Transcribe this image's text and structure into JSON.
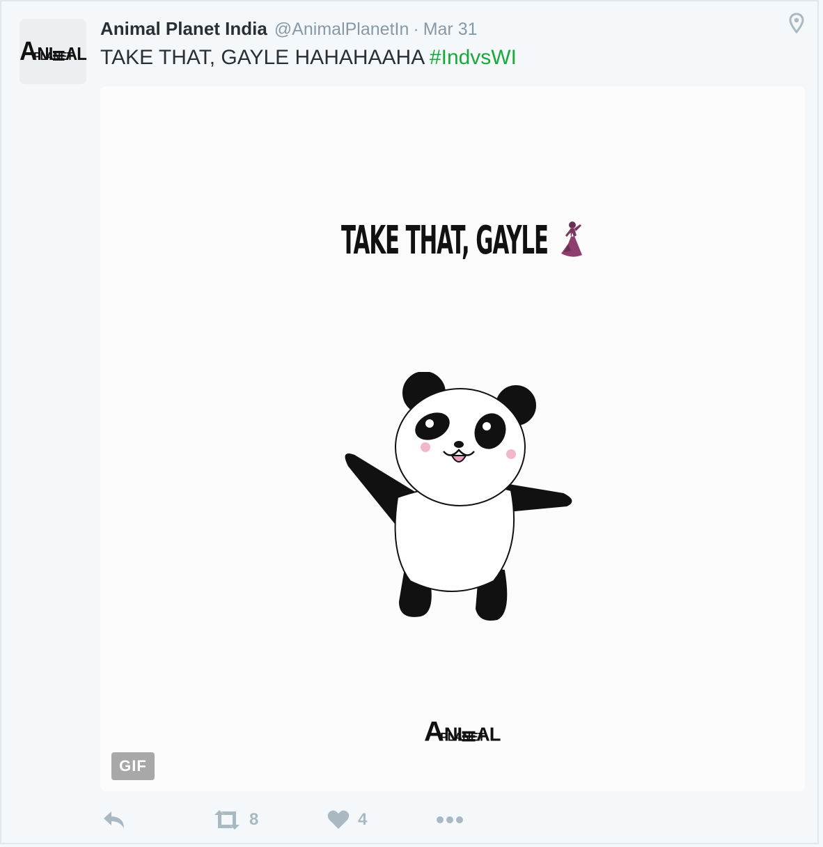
{
  "tweet": {
    "author_name": "Animal Planet India",
    "author_handle": "@AnimalPlanetIn",
    "separator": "·",
    "date": "Mar 31",
    "text": "TAKE THAT, GAYLE HAHAHAAHA ",
    "hashtag": "#IndvsWI",
    "avatar_logo": {
      "line1_a": "A",
      "line1_b": "NI",
      "line1_c": "AL",
      "line2": "PLANET"
    }
  },
  "media": {
    "caption": "TAKE THAT, GAYLE",
    "caption_emoji": "dancer-emoji",
    "logo": {
      "line1_a": "A",
      "line1_b": "NI",
      "line1_c": "AL",
      "line2": "PLANET"
    },
    "badge": "GIF"
  },
  "actions": {
    "retweet_count": "8",
    "like_count": "4"
  },
  "icons": {
    "location": "location-pin-icon",
    "reply": "reply-icon",
    "retweet": "retweet-icon",
    "like": "heart-icon",
    "more": "more-icon"
  },
  "colors": {
    "hashtag": "#1ba83a",
    "muted": "#8899a6",
    "icon": "#aab8c2",
    "gif_badge": "#a8a8a8"
  }
}
